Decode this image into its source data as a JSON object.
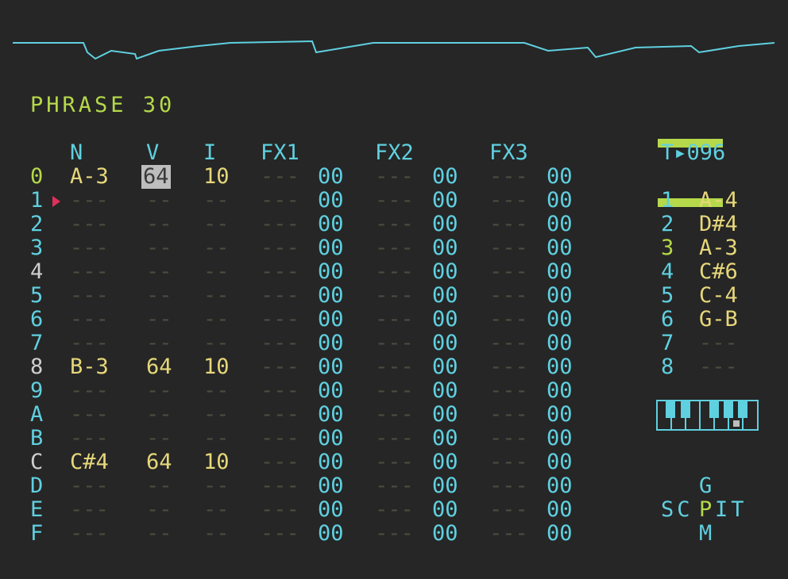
{
  "title": "PHRASE 30",
  "headers": {
    "n": "N",
    "v": "V",
    "i": "I",
    "fx1": "FX1",
    "fx2": "FX2",
    "fx3": "FX3"
  },
  "tempo": "T▸096",
  "rows": [
    {
      "idx": "0",
      "note": "A-3",
      "vel": "64",
      "inst": "10",
      "fx1": "00",
      "fx2": "00",
      "fx3": "00"
    },
    {
      "idx": "1",
      "note": "---",
      "vel": "--",
      "inst": "--",
      "fx1": "00",
      "fx2": "00",
      "fx3": "00"
    },
    {
      "idx": "2",
      "note": "---",
      "vel": "--",
      "inst": "--",
      "fx1": "00",
      "fx2": "00",
      "fx3": "00"
    },
    {
      "idx": "3",
      "note": "---",
      "vel": "--",
      "inst": "--",
      "fx1": "00",
      "fx2": "00",
      "fx3": "00"
    },
    {
      "idx": "4",
      "note": "---",
      "vel": "--",
      "inst": "--",
      "fx1": "00",
      "fx2": "00",
      "fx3": "00"
    },
    {
      "idx": "5",
      "note": "---",
      "vel": "--",
      "inst": "--",
      "fx1": "00",
      "fx2": "00",
      "fx3": "00"
    },
    {
      "idx": "6",
      "note": "---",
      "vel": "--",
      "inst": "--",
      "fx1": "00",
      "fx2": "00",
      "fx3": "00"
    },
    {
      "idx": "7",
      "note": "---",
      "vel": "--",
      "inst": "--",
      "fx1": "00",
      "fx2": "00",
      "fx3": "00"
    },
    {
      "idx": "8",
      "note": "B-3",
      "vel": "64",
      "inst": "10",
      "fx1": "00",
      "fx2": "00",
      "fx3": "00"
    },
    {
      "idx": "9",
      "note": "---",
      "vel": "--",
      "inst": "--",
      "fx1": "00",
      "fx2": "00",
      "fx3": "00"
    },
    {
      "idx": "A",
      "note": "---",
      "vel": "--",
      "inst": "--",
      "fx1": "00",
      "fx2": "00",
      "fx3": "00"
    },
    {
      "idx": "B",
      "note": "---",
      "vel": "--",
      "inst": "--",
      "fx1": "00",
      "fx2": "00",
      "fx3": "00"
    },
    {
      "idx": "C",
      "note": "C#4",
      "vel": "64",
      "inst": "10",
      "fx1": "00",
      "fx2": "00",
      "fx3": "00"
    },
    {
      "idx": "D",
      "note": "---",
      "vel": "--",
      "inst": "--",
      "fx1": "00",
      "fx2": "00",
      "fx3": "00"
    },
    {
      "idx": "E",
      "note": "---",
      "vel": "--",
      "inst": "--",
      "fx1": "00",
      "fx2": "00",
      "fx3": "00"
    },
    {
      "idx": "F",
      "note": "---",
      "vel": "--",
      "inst": "--",
      "fx1": "00",
      "fx2": "00",
      "fx3": "00"
    }
  ],
  "fx_placeholder": "---",
  "tracks": [
    {
      "num": "1",
      "note": "A-4"
    },
    {
      "num": "2",
      "note": "D#4"
    },
    {
      "num": "3",
      "note": "A-3"
    },
    {
      "num": "4",
      "note": "C#6"
    },
    {
      "num": "5",
      "note": "C-4"
    },
    {
      "num": "6",
      "note": "G-B"
    },
    {
      "num": "7",
      "note": "---"
    },
    {
      "num": "8",
      "note": "---"
    }
  ],
  "nav": {
    "top": "G",
    "left": "SC",
    "current": "P",
    "right": "IT",
    "bottom": "M"
  },
  "colors": {
    "background": "#262626",
    "accent": "#b5d94a",
    "cyan": "#5fd0e0",
    "note": "#e6d77a",
    "cursor": "#bdbdbd",
    "playhead": "#e0305a"
  }
}
